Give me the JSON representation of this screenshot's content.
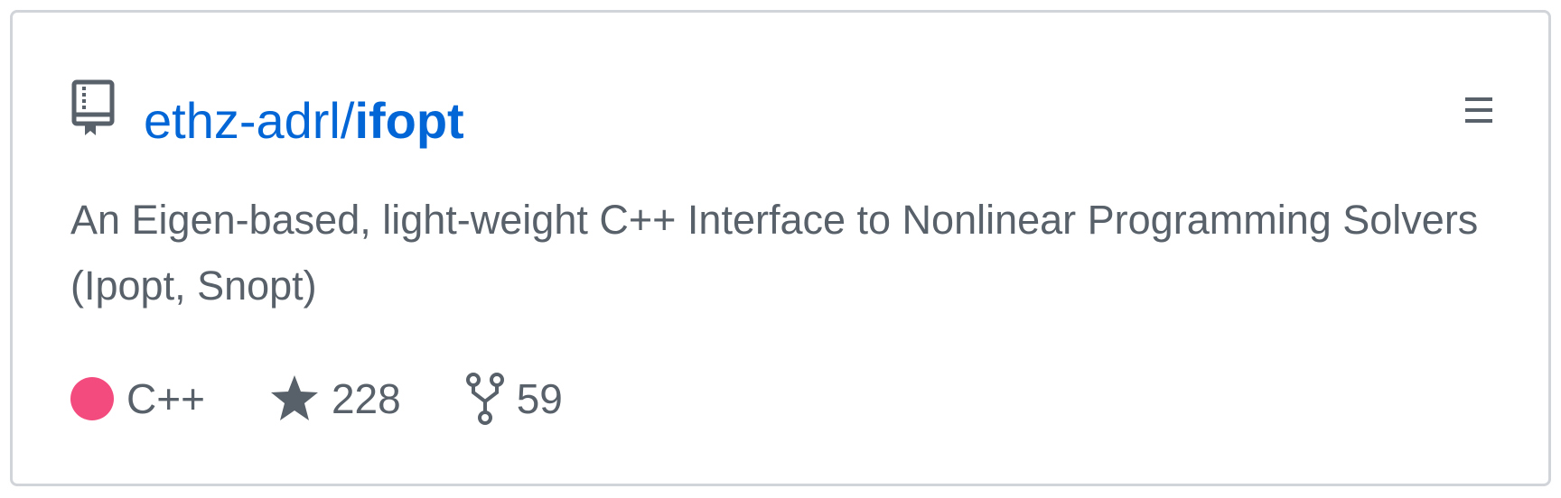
{
  "repo": {
    "owner": "ethz-adrl/",
    "name": "ifopt",
    "description": "An Eigen-based, light-weight C++ Interface to Nonlinear Programming Solvers (Ipopt, Snopt)",
    "language": "C++",
    "language_color": "#f34b7d",
    "stars": "228",
    "forks": "59"
  },
  "icons": {
    "repo": "book-icon",
    "menu": "hamburger-menu-icon",
    "star": "star-icon",
    "fork": "fork-icon"
  },
  "colors": {
    "link": "#0366d6",
    "text": "#586069",
    "border": "#d1d5da"
  }
}
